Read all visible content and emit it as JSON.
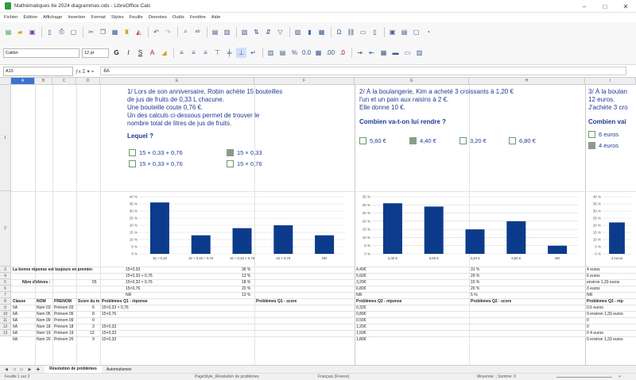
{
  "window": {
    "title": "Mathématiques 6e 2024 diagrammes.ods - LibreOffice Calc",
    "controls": [
      "–",
      "□",
      "✕"
    ]
  },
  "menu": [
    "Fichier",
    "Édition",
    "Affichage",
    "Insertion",
    "Format",
    "Styles",
    "Feuille",
    "Données",
    "Outils",
    "Fenêtre",
    "Aide"
  ],
  "toolbar2": {
    "font_name": "Calibri",
    "font_size": "12 pt",
    "bold": "G",
    "italic": "I",
    "underline": "S"
  },
  "formula": {
    "name_box": "A15",
    "fx": "ƒx Σ ▾ =",
    "content": "8A"
  },
  "columns": [
    "A",
    "B",
    "C",
    "D",
    "E",
    "F",
    "G",
    "H",
    "I"
  ],
  "rows": [
    "1",
    "2",
    "3",
    "4",
    "5",
    "6",
    "7",
    "8",
    "9",
    "10",
    "11",
    "12",
    "13"
  ],
  "q1": {
    "title_lines": [
      "1/ Lors de son anniversaire, Robin achète 15 bouteilles",
      "de jus de fruits de 0,33 L chacune.",
      "Une bouteille coute 0,76 €.",
      "Un des calculs ci-dessous permet de trouver le",
      "nombre total de litres de jus de fruits."
    ],
    "question": "Lequel ?",
    "options": [
      "15 + 0,33 + 0,76",
      "15 × 0,33",
      "15 × 0,33 × 0,76",
      "15 × 0,76"
    ]
  },
  "q2": {
    "title_lines": [
      "2/ À la boulangerie, Kim a acheté 3 croissants à 1,20 €",
      "l'un et un pain aux raisins à 2 €.",
      "Elle donne 10 €."
    ],
    "question": "Combien va-t-on lui rendre ?",
    "options": [
      "5,60 €",
      "4,40 €",
      "3,20 €",
      "6,80 €"
    ]
  },
  "q3": {
    "title_lines": [
      "3/ À la boulan",
      "12 euros.",
      "J'achète 3 cro"
    ],
    "question": "Combien vai",
    "options": [
      "6 euros",
      "4 euros"
    ]
  },
  "chart_data": [
    {
      "type": "bar",
      "categories": [
        "15 + 0,33",
        "15 + 0,33 + 0,76",
        "15 + 0,33 × 0,76",
        "15 × 0,76",
        "NR"
      ],
      "values": [
        36,
        13,
        18,
        20,
        13
      ],
      "ylim": [
        0,
        40
      ],
      "ytick_labels": [
        "0 %",
        "5 %",
        "10 %",
        "15 %",
        "20 %",
        "25 %",
        "30 %",
        "35 %",
        "40 %"
      ],
      "color": "#0d3b8c"
    },
    {
      "type": "bar",
      "categories": [
        "4,40 €",
        "5,60 €",
        "3,20 €",
        "6,80 €",
        "NR"
      ],
      "values": [
        31,
        29,
        15,
        20,
        5
      ],
      "ylim": [
        0,
        35
      ],
      "ytick_labels": [
        "0 %",
        "5 %",
        "10 %",
        "15 %",
        "20 %",
        "25 %",
        "30 %",
        "35 %"
      ],
      "color": "#0d3b8c"
    },
    {
      "type": "bar",
      "categories": [
        "4 euros"
      ],
      "values": [
        22
      ],
      "ylim": [
        0,
        40
      ],
      "ytick_labels": [
        "0 %",
        "5 %",
        "10 %",
        "15 %",
        "20 %",
        "25 %",
        "30 %",
        "35 %",
        "40 %"
      ],
      "color": "#0d3b8c"
    }
  ],
  "summary": {
    "note": "La bonne réponse est toujours en premier.",
    "eleves_label": "Nbre d'élèves :",
    "eleves_count": "55",
    "q1_answers": [
      "15×0,33",
      "15×0,33 + 0,76",
      "15×0,33 × 0,76",
      "15×0,76",
      "NR"
    ],
    "q1_pcts": [
      "36 %",
      "13 %",
      "18 %",
      "20 %",
      "13 %"
    ],
    "q2_answers": [
      "4,40€",
      "5,60€",
      "3,20€",
      "6,80€",
      "NR"
    ],
    "q2_pcts": [
      "31 %",
      "29 %",
      "15 %",
      "20 %",
      "5 %"
    ],
    "q3_answers": [
      "4 euros",
      "6 euros",
      "environ 1,33 euros",
      "3 euros",
      "NR"
    ]
  },
  "table": {
    "headers": [
      "Classe",
      "NOM",
      "PRENOM",
      "Score du te",
      "Problèmes Q1 - réponse",
      "Problèmes Q1 - score",
      "Problèmes Q2 - réponse",
      "Problèmes Q2 - score",
      "Problèmes Q3 - rép"
    ],
    "rows": [
      [
        "6A",
        "Nom 03",
        "Prénom 03",
        "6",
        "15×0,33 × 0,76",
        "",
        "0,32€",
        "",
        "0,6 euros"
      ],
      [
        "6A",
        "Nom 05",
        "Prénom 05",
        "8",
        "15×0,76",
        "",
        "0,80€",
        "",
        "0 environ 1,33 euros"
      ],
      [
        "6A",
        "Nom 09",
        "Prénom 09",
        "0",
        "",
        "",
        "0,50€",
        "",
        "0"
      ],
      [
        "6A",
        "Nom 18",
        "Prénom 18",
        "3",
        "15×0,33",
        "",
        "1,20€",
        "",
        "0"
      ],
      [
        "6A",
        "Nom 19",
        "Prénom 19",
        "13",
        "15×0,33",
        "",
        "1,50€",
        "",
        "0 4 euros"
      ],
      [
        "6A",
        "Nom 20",
        "Prénom 20",
        "9",
        "15×0,33",
        "",
        "1,80€",
        "",
        "0 environ 1,33 euros"
      ]
    ]
  },
  "sheets": {
    "counter": "Feuille 1 sur 2",
    "tabs": [
      "Résolution de problèmes",
      "Automatismes"
    ]
  },
  "status": {
    "sheet": "PageStyle_Résolution de problèmes",
    "lang": "Français (France)",
    "stats": "Moyenne: ; Somme: 0",
    "zoom": "+"
  }
}
